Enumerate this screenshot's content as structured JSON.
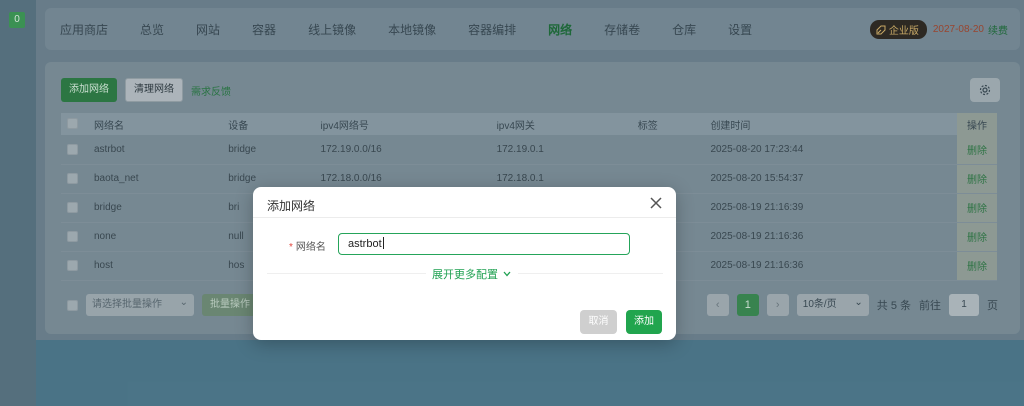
{
  "rail": {
    "badge": "0"
  },
  "nav": {
    "items": [
      "应用商店",
      "总览",
      "网站",
      "容器",
      "线上镜像",
      "本地镜像",
      "容器编排",
      "网络",
      "存储卷",
      "仓库",
      "设置"
    ],
    "active_index": 7,
    "enterprise_label": "企业版",
    "expiry_date": "2027-08-20",
    "renew_label": "续费"
  },
  "toolbar": {
    "add_network": "添加网络",
    "clean_network": "清理网络",
    "feedback": "需求反馈"
  },
  "table": {
    "headers": [
      "网络名",
      "设备",
      "ipv4网络号",
      "ipv4网关",
      "标签",
      "创建时间",
      "操作"
    ],
    "rows": [
      {
        "name": "astrbot",
        "device": "bridge",
        "subnet": "172.19.0.0/16",
        "gateway": "172.19.0.1",
        "label": "",
        "created": "2025-08-20 17:23:44",
        "action": "删除"
      },
      {
        "name": "baota_net",
        "device": "bridge",
        "subnet": "172.18.0.0/16",
        "gateway": "172.18.0.1",
        "label": "",
        "created": "2025-08-20 15:54:37",
        "action": "删除"
      },
      {
        "name": "bridge",
        "device": "bri",
        "subnet": "",
        "gateway": "",
        "label": "",
        "created": "2025-08-19 21:16:39",
        "action": "删除"
      },
      {
        "name": "none",
        "device": "null",
        "subnet": "",
        "gateway": "",
        "label": "",
        "created": "2025-08-19 21:16:36",
        "action": "删除"
      },
      {
        "name": "host",
        "device": "hos",
        "subnet": "",
        "gateway": "",
        "label": "",
        "created": "2025-08-19 21:16:36",
        "action": "删除"
      }
    ]
  },
  "footer": {
    "batch_placeholder": "请选择批量操作",
    "batch_button": "批量操作",
    "current_page": "1",
    "page_size": "10条/页",
    "total": "共 5 条",
    "goto_label": "前往",
    "goto_value": "1",
    "page_unit": "页"
  },
  "dialog": {
    "title": "添加网络",
    "field_label": "网络名",
    "field_value": "astrbot",
    "expand_label": "展开更多配置",
    "cancel": "取消",
    "confirm": "添加"
  }
}
